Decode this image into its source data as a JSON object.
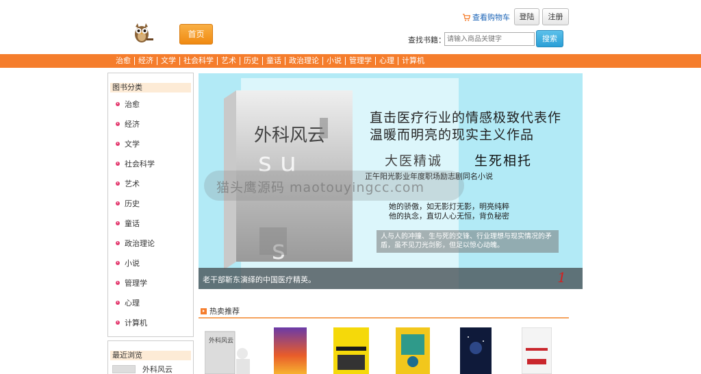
{
  "header": {
    "cart_label": "查看购物车",
    "login_label": "登陆",
    "register_label": "注册",
    "home_label": "首页",
    "search_label": "查找书籍：",
    "search_placeholder": "请输入商品关键字",
    "search_button": "搜索"
  },
  "nav": {
    "items": [
      "治愈",
      "经济",
      "文学",
      "社会科学",
      "艺术",
      "历史",
      "童话",
      "政治理论",
      "小说",
      "管理学",
      "心理",
      "计算机"
    ]
  },
  "sidebar": {
    "category_title": "图书分类",
    "categories": [
      "治愈",
      "经济",
      "文学",
      "社会科学",
      "艺术",
      "历史",
      "童话",
      "政治理论",
      "小说",
      "管理学",
      "心理",
      "计算机"
    ],
    "recent_title": "最近浏览",
    "recent_items": [
      "外科风云"
    ]
  },
  "banner": {
    "book_title": "外科风云",
    "headline1": "直击医疗行业的情感极致代表作",
    "headline2": "温暖而明亮的现实主义作品",
    "slogan1": "大医精诚",
    "slogan2": "生死相托",
    "subline": "正午阳光影业年度职场励志剧同名小说",
    "verse1": "她的骄傲，如无影灯无影，明亮纯粹",
    "verse2": "他的执念，直切人心无恒，背负秘密",
    "quote": "人与人的冲撞、生与死的交锋、行业理想与现实情况的矛盾，虽不见刀光剑影，但足以惊心动魄。",
    "watermark": "猫头鹰源码 maotouyingcc.com",
    "caption": "老干部靳东演绎的中国医疗精英。",
    "slide_number": "1"
  },
  "hot": {
    "title": "热卖推荐",
    "covers": [
      "外科风云"
    ]
  },
  "colors": {
    "accent": "#f57d2c",
    "banner_bg": "#b2eaf6",
    "search_button": "#2a9fd6",
    "bullet": "#e43a6f"
  }
}
